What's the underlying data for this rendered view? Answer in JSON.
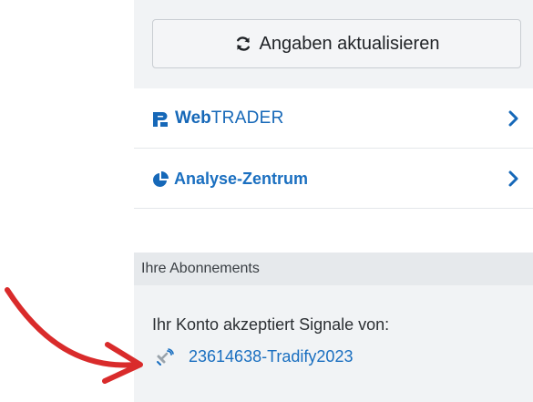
{
  "refresh": {
    "label": "Angaben aktualisieren",
    "icon": "refresh-icon"
  },
  "menu": {
    "items": [
      {
        "id": "webtrader",
        "label_bold": "Web",
        "label_regular": "TRADER",
        "icon": "webtrader-logo-icon"
      },
      {
        "id": "analyse",
        "label": "Analyse-Zentrum",
        "icon": "pie-chart-icon"
      }
    ]
  },
  "subscriptions": {
    "header": "Ihre Abonnements",
    "text": "Ihr Konto akzeptiert Signale von:",
    "link_label": "23614638-Tradify2023",
    "link_icon": "satellite-icon"
  },
  "colors": {
    "link_blue": "#1a6fc0",
    "annotation_red": "#d92b2b",
    "panel_grey": "#f1f3f5",
    "header_grey": "#e6e9ec"
  }
}
